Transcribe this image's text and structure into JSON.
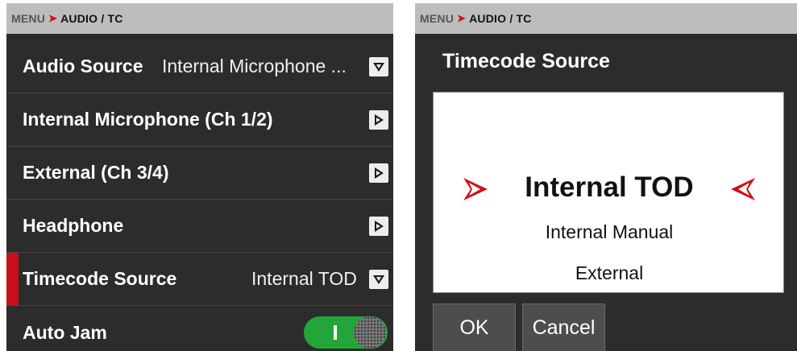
{
  "left": {
    "breadcrumb": {
      "menu": "MENU",
      "section": "AUDIO / TC"
    },
    "rows": [
      {
        "label": "Audio Source",
        "value": "Internal Microphone ...",
        "control": "dropdown-icon"
      },
      {
        "label": "Internal Microphone (Ch 1/2)",
        "control": "chevron-right-icon"
      },
      {
        "label": "External (Ch 3/4)",
        "control": "chevron-right-icon"
      },
      {
        "label": "Headphone",
        "control": "chevron-right-icon"
      },
      {
        "label": "Timecode Source",
        "value": "Internal TOD",
        "control": "dropdown-icon",
        "selected": true
      },
      {
        "label": "Auto Jam",
        "control": "toggle",
        "toggle_on": true
      }
    ]
  },
  "right": {
    "breadcrumb": {
      "menu": "MENU",
      "section": "AUDIO / TC"
    },
    "dialog": {
      "title": "Timecode Source",
      "options": [
        "Internal TOD",
        "Internal Manual",
        "External"
      ],
      "selected_option": "Internal TOD",
      "ok_label": "OK",
      "cancel_label": "Cancel"
    }
  },
  "colors": {
    "accent": "#c8101a",
    "panel": "#2c2c2c",
    "breadcrumb_bg": "#bdbdbd",
    "toggle_on": "#22a63a"
  }
}
